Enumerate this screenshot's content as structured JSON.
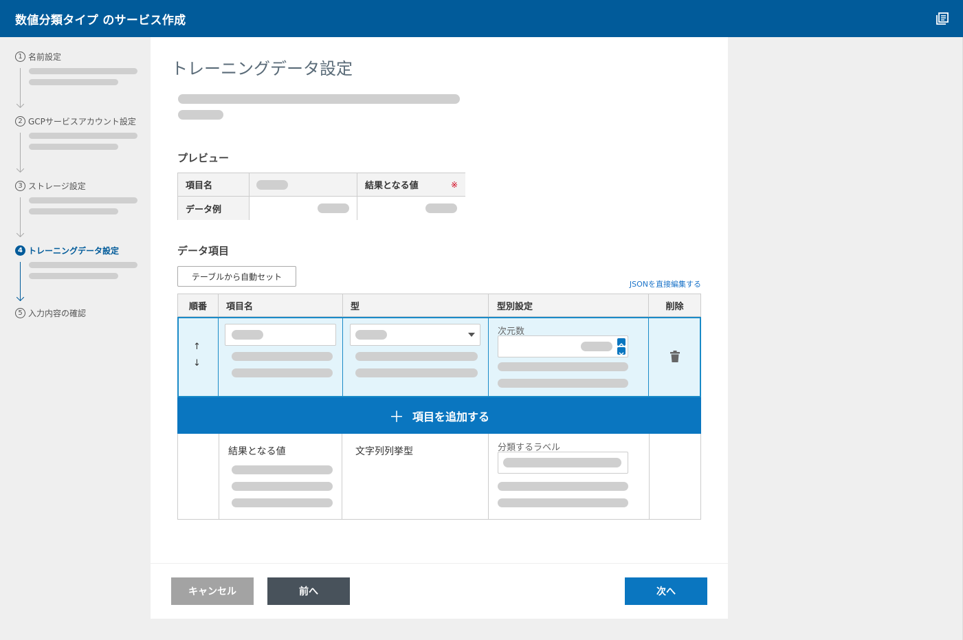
{
  "header": {
    "title": "数値分類タイプ のサービス作成",
    "doc_icon": "document-stack-icon"
  },
  "stepper": {
    "steps": [
      {
        "num": "1",
        "label": "名前設定"
      },
      {
        "num": "2",
        "label": "GCPサービスアカウント設定"
      },
      {
        "num": "3",
        "label": "ストレージ設定"
      },
      {
        "num": "4",
        "label": "トレーニングデータ設定"
      },
      {
        "num": "5",
        "label": "入力内容の確認"
      }
    ],
    "active_index": 3
  },
  "main": {
    "title": "トレーニングデータ設定",
    "preview": {
      "title": "プレビュー",
      "row1_label": "項目名",
      "row2_label": "データ例",
      "result_label": "結果となる値",
      "required_mark": "※"
    },
    "data_items": {
      "title": "データ項目",
      "autoset_button": "テーブルから自動セット",
      "json_link": "JSONを直接編集する",
      "columns": [
        "順番",
        "項目名",
        "型",
        "型別設定",
        "削除"
      ],
      "row1": {
        "up": "↑",
        "down": "↓",
        "type_setting_label": "次元数"
      },
      "add_button": "項目を追加する",
      "add_icon": "＋",
      "row2": {
        "name": "結果となる値",
        "type": "文字列列挙型",
        "type_setting_label": "分類するラベル"
      }
    }
  },
  "footer": {
    "cancel": "キャンセル",
    "prev": "前へ",
    "next": "次へ"
  },
  "colors": {
    "brand": "#015b9a",
    "accent": "#0a76c0",
    "selected_row": "#e3f4fb",
    "skeleton": "#cfcfcf"
  }
}
